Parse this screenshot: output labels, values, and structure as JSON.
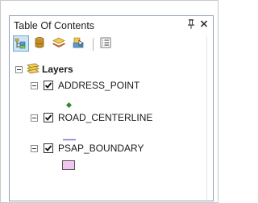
{
  "window": {
    "title": "Table Of Contents",
    "pin_glyph": "ℵ",
    "close_glyph": "×"
  },
  "toolbar": {
    "buttons": [
      {
        "icon": "list-by-drawing-order-icon",
        "active": true
      },
      {
        "icon": "list-by-source-icon",
        "active": false
      },
      {
        "icon": "list-by-visibility-icon",
        "active": false
      },
      {
        "icon": "list-by-selection-icon",
        "active": false
      },
      {
        "icon": "options-icon",
        "active": false
      }
    ]
  },
  "tree": {
    "root_label": "Layers",
    "layers": [
      {
        "name": "ADDRESS_POINT",
        "checked": true,
        "symbol": "point",
        "color": "#2e8b2e"
      },
      {
        "name": "ROAD_CENTERLINE",
        "checked": true,
        "symbol": "line",
        "color": "#8a6fd8"
      },
      {
        "name": "PSAP_BOUNDARY",
        "checked": true,
        "symbol": "polygon",
        "color": "#f0c6ef"
      }
    ]
  }
}
